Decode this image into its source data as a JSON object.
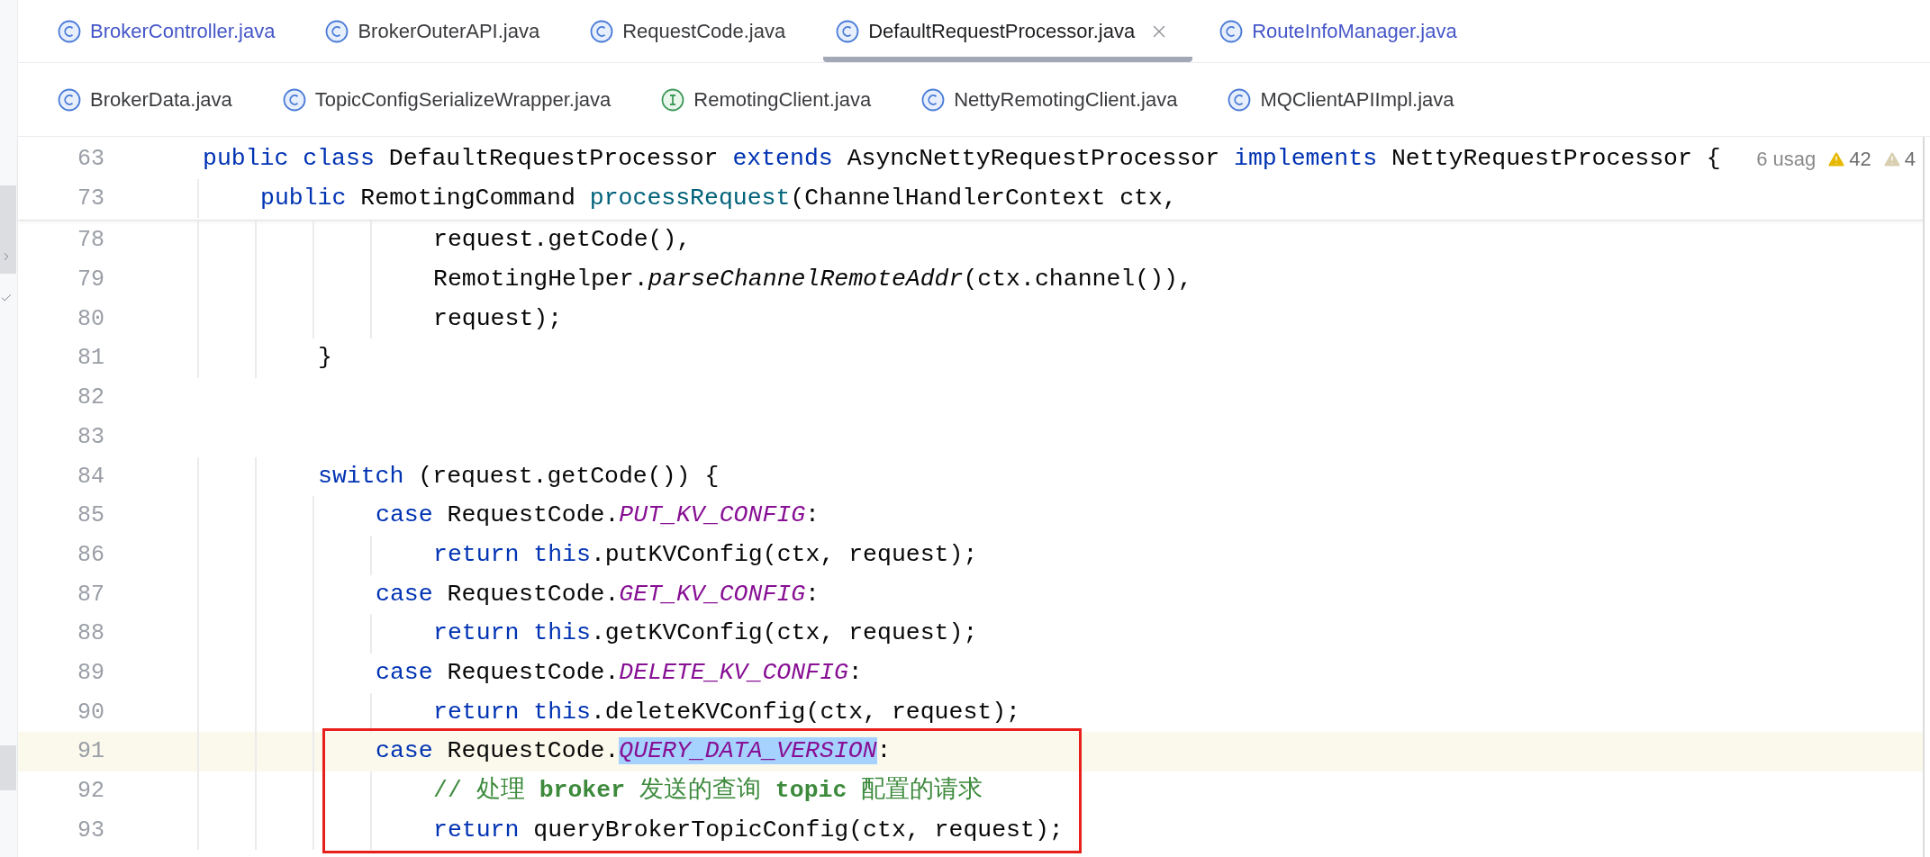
{
  "tab_rows": [
    [
      {
        "label": "BrokerController.java",
        "kind": "class",
        "vcs_modified": true,
        "selected": false
      },
      {
        "label": "BrokerOuterAPI.java",
        "kind": "class",
        "vcs_modified": false,
        "selected": false
      },
      {
        "label": "RequestCode.java",
        "kind": "class",
        "vcs_modified": false,
        "selected": false
      },
      {
        "label": "DefaultRequestProcessor.java",
        "kind": "class",
        "vcs_modified": false,
        "selected": true
      },
      {
        "label": "RouteInfoManager.java",
        "kind": "class",
        "vcs_modified": true,
        "selected": false
      }
    ],
    [
      {
        "label": "BrokerData.java",
        "kind": "class",
        "vcs_modified": false,
        "selected": false
      },
      {
        "label": "TopicConfigSerializeWrapper.java",
        "kind": "class",
        "vcs_modified": false,
        "selected": false
      },
      {
        "label": "RemotingClient.java",
        "kind": "interface",
        "vcs_modified": false,
        "selected": false
      },
      {
        "label": "NettyRemotingClient.java",
        "kind": "class",
        "vcs_modified": false,
        "selected": false
      },
      {
        "label": "MQClientAPIImpl.java",
        "kind": "class",
        "vcs_modified": false,
        "selected": false
      }
    ]
  ],
  "inspections": {
    "usages_hint": "6 usag",
    "counters": [
      {
        "kind": "warning",
        "count": "42"
      },
      {
        "kind": "weak_warning",
        "count": "4"
      }
    ]
  },
  "sticky_lines": [
    {
      "number": "63",
      "tokens": [
        {
          "kind": "keyword",
          "text": "public class "
        },
        {
          "kind": "plain",
          "text": "DefaultRequestProcessor "
        },
        {
          "kind": "keyword",
          "text": "extends "
        },
        {
          "kind": "plain",
          "text": "AsyncNettyRequestProcessor "
        },
        {
          "kind": "keyword",
          "text": "implements "
        },
        {
          "kind": "plain",
          "text": "NettyRequestProcessor {"
        }
      ]
    },
    {
      "number": "73",
      "tokens": [
        {
          "kind": "keyword",
          "text": "    public "
        },
        {
          "kind": "plain",
          "text": "RemotingCommand "
        },
        {
          "kind": "method",
          "text": "processRequest"
        },
        {
          "kind": "plain",
          "text": "(ChannelHandlerContext ctx,"
        }
      ]
    }
  ],
  "lines": [
    {
      "number": "78",
      "current": false,
      "boxed": false,
      "tokens": [
        {
          "kind": "plain",
          "text": "                request.getCode(),"
        }
      ]
    },
    {
      "number": "79",
      "current": false,
      "boxed": false,
      "tokens": [
        {
          "kind": "plain",
          "text": "                RemotingHelper."
        },
        {
          "kind": "static",
          "text": "parseChannelRemoteAddr"
        },
        {
          "kind": "plain",
          "text": "(ctx.channel()),"
        }
      ]
    },
    {
      "number": "80",
      "current": false,
      "boxed": false,
      "tokens": [
        {
          "kind": "plain",
          "text": "                request);"
        }
      ]
    },
    {
      "number": "81",
      "current": false,
      "boxed": false,
      "tokens": [
        {
          "kind": "plain",
          "text": "        }"
        }
      ]
    },
    {
      "number": "82",
      "current": false,
      "boxed": false
    },
    {
      "number": "83",
      "current": false,
      "boxed": false
    },
    {
      "number": "84",
      "current": false,
      "boxed": false,
      "tokens": [
        {
          "kind": "keyword",
          "text": "        switch "
        },
        {
          "kind": "plain",
          "text": "(request.getCode()) {"
        }
      ]
    },
    {
      "number": "85",
      "current": false,
      "boxed": false,
      "tokens": [
        {
          "kind": "keyword",
          "text": "            case "
        },
        {
          "kind": "plain",
          "text": "RequestCode."
        },
        {
          "kind": "constant",
          "text": "PUT_KV_CONFIG"
        },
        {
          "kind": "plain",
          "text": ":"
        }
      ]
    },
    {
      "number": "86",
      "current": false,
      "boxed": false,
      "tokens": [
        {
          "kind": "keyword",
          "text": "                return this"
        },
        {
          "kind": "plain",
          "text": ".putKVConfig(ctx, request);"
        }
      ]
    },
    {
      "number": "87",
      "current": false,
      "boxed": false,
      "tokens": [
        {
          "kind": "keyword",
          "text": "            case "
        },
        {
          "kind": "plain",
          "text": "RequestCode."
        },
        {
          "kind": "constant",
          "text": "GET_KV_CONFIG"
        },
        {
          "kind": "plain",
          "text": ":"
        }
      ]
    },
    {
      "number": "88",
      "current": false,
      "boxed": false,
      "tokens": [
        {
          "kind": "keyword",
          "text": "                return this"
        },
        {
          "kind": "plain",
          "text": ".getKVConfig(ctx, request);"
        }
      ]
    },
    {
      "number": "89",
      "current": false,
      "boxed": false,
      "tokens": [
        {
          "kind": "keyword",
          "text": "            case "
        },
        {
          "kind": "plain",
          "text": "RequestCode."
        },
        {
          "kind": "constant",
          "text": "DELETE_KV_CONFIG"
        },
        {
          "kind": "plain",
          "text": ":"
        }
      ]
    },
    {
      "number": "90",
      "current": false,
      "boxed": false,
      "tokens": [
        {
          "kind": "keyword",
          "text": "                return this"
        },
        {
          "kind": "plain",
          "text": ".deleteKVConfig(ctx, request);"
        }
      ]
    },
    {
      "number": "91",
      "current": true,
      "boxed": true,
      "tokens": [
        {
          "kind": "keyword",
          "text": "            case "
        },
        {
          "kind": "plain",
          "text": "RequestCode."
        },
        {
          "kind": "constant",
          "text": "QUERY_DATA_VERSION",
          "selected": true
        },
        {
          "kind": "plain",
          "text": ":"
        }
      ]
    },
    {
      "number": "92",
      "current": false,
      "boxed": true,
      "tokens": [
        {
          "kind": "comment",
          "text": "                // 处理 "
        },
        {
          "kind": "comment_bold",
          "text": "broker"
        },
        {
          "kind": "comment",
          "text": " 发送的查询 "
        },
        {
          "kind": "comment_bold",
          "text": "topic"
        },
        {
          "kind": "comment",
          "text": " 配置的请求"
        }
      ]
    },
    {
      "number": "93",
      "current": false,
      "boxed": true,
      "tokens": [
        {
          "kind": "keyword",
          "text": "                return "
        },
        {
          "kind": "plain",
          "text": "queryBrokerTopicConfig(ctx, request);"
        }
      ]
    }
  ]
}
